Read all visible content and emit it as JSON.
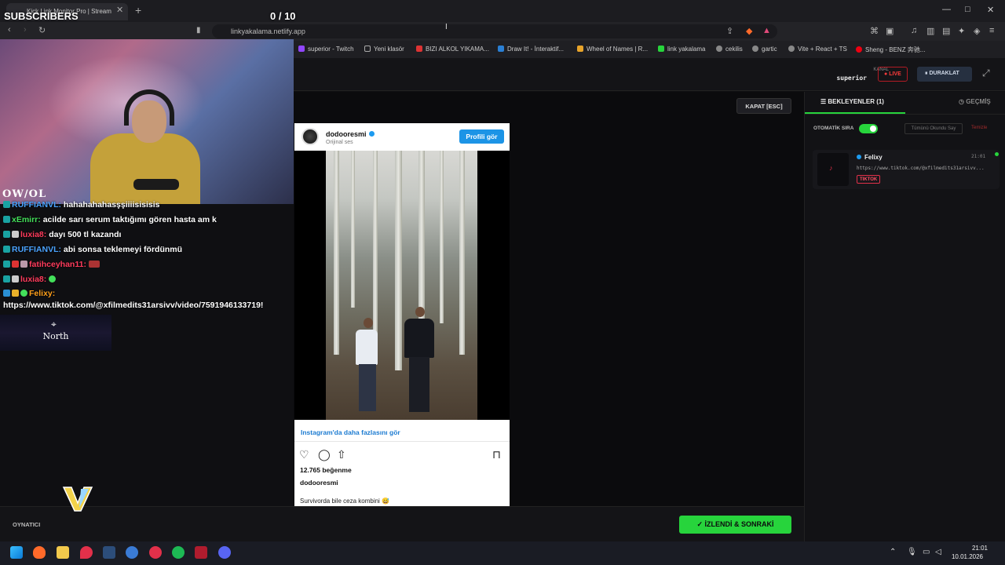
{
  "browser": {
    "tab_title": "Kick Link Monitor Pro | Stream",
    "tab_close": "✕",
    "new_tab": "+",
    "url": "linkyakalama.netlify.app",
    "bookmarks": [
      "superior - Twitch",
      "Yeni klasör",
      "BIZI ALKOL YIKAMA...",
      "Draw It! - İnteraktif...",
      "Wheel of Names | R...",
      "link yakalama",
      "cekilis",
      "gartic",
      "Vite + React + TS",
      "Sheng - BENZ 奔驰..."
    ]
  },
  "header": {
    "kanal_label": "KANAL",
    "kanal_name": "superior",
    "live": "LIVE",
    "pause": "DURAKLAT"
  },
  "viewer": {
    "close_button": "KAPAT [ESC]",
    "instagram": {
      "username": "dodooresmi",
      "subtitle": "Orijinal ses",
      "profile_button": "Profili gör",
      "more_link": "Instagram'da daha fazlasını gör",
      "likes": "12.765 beğenme",
      "caption_user": "dodooresmi",
      "caption": "Survivorda bile ceza kombini 😅"
    }
  },
  "sidebar": {
    "tab_queue": "BEKLEYENLER (1)",
    "tab_history": "GEÇMİŞ",
    "auto_queue_label": "OTOMATİK SIRA",
    "auto_queue_on": true,
    "mark_all_read": "Tümünü Okundu Say",
    "clear": "Temizle",
    "queue": [
      {
        "user": "Felixy",
        "time": "21:01",
        "url": "https://www.tiktok.com/@xfilmedits31arsivv...",
        "platform": "TIKTOK"
      }
    ]
  },
  "footer": {
    "player_label": "OYNATICI",
    "next_button": "İZLENDİ & SONRAKİ"
  },
  "overlay": {
    "subscribers_label": "SUBSCRIBERS",
    "subscribers_count": "0 / 10",
    "owl_text": "OW/OL",
    "chat": [
      {
        "user": "RUFFIANVL:",
        "text": "hahahahahasşşiiiisisisis",
        "color": "#4aa3ff"
      },
      {
        "user": "xEmirr:",
        "text": "acilde sarı serum taktığımı gören hasta am k",
        "color": "#43e05a"
      },
      {
        "user": "luxia8:",
        "text": "dayı 500 tl kazandı",
        "color": "#ff3b5c"
      },
      {
        "user": "RUFFIANVL:",
        "text": "abi sonsa teklemeyi fördünmü",
        "color": "#4aa3ff"
      },
      {
        "user": "fatihceyhan11:",
        "text": "",
        "color": "#ff3b5c"
      },
      {
        "user": "luxia8:",
        "text": "",
        "color": "#ff3b5c"
      },
      {
        "user": "Felixy:",
        "text": "",
        "color": "#ff9f1a"
      }
    ],
    "chat_link": "https://www.tiktok.com/@xfilmedits31arsivv/video/7591946133719!",
    "north": "North"
  },
  "taskbar": {
    "time": "21:01",
    "date": "10.01.2026"
  },
  "colors": {
    "accent_green": "#27d43c",
    "live_red": "#ff3b3b",
    "ig_blue": "#1c94e6"
  }
}
